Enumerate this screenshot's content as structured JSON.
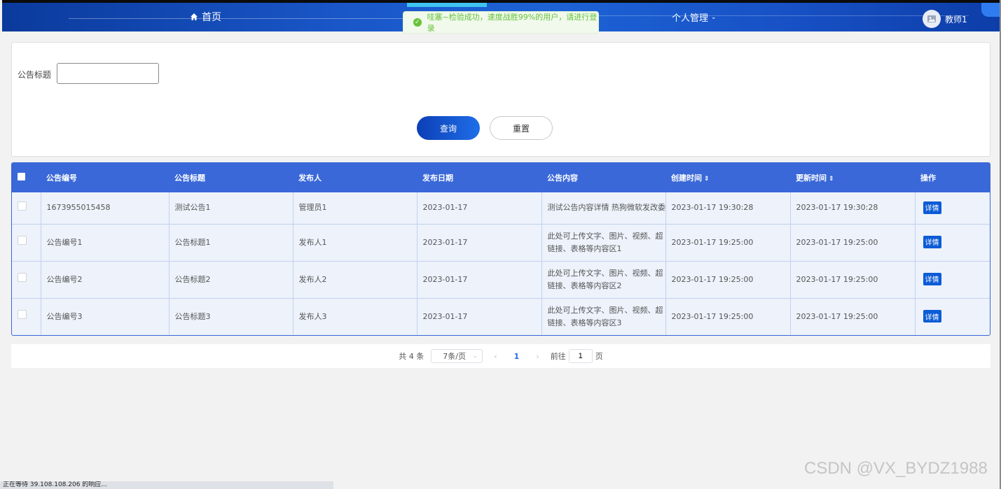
{
  "nav": {
    "home_label": "首页",
    "personal_label": "个人管理",
    "user_name": "教师1"
  },
  "toast": {
    "message": "哇塞~检验成功，速度战胜99%的用户，请进行登录",
    "color": "#67c23a"
  },
  "search": {
    "title_label": "公告标题",
    "title_value": "",
    "query_label": "查询",
    "reset_label": "重置"
  },
  "table": {
    "columns": [
      "公告编号",
      "公告标题",
      "发布人",
      "发布日期",
      "公告内容",
      "创建时间",
      "更新时间",
      "操作"
    ],
    "detail_label": "详情",
    "rows": [
      {
        "id": "1673955015458",
        "title": "测试公告1",
        "publisher": "管理员1",
        "date": "2023-01-17",
        "content": "测试公告内容详情 热狗微软发改委",
        "created": "2023-01-17 19:30:28",
        "updated": "2023-01-17 19:30:28"
      },
      {
        "id": "公告编号1",
        "title": "公告标题1",
        "publisher": "发布人1",
        "date": "2023-01-17",
        "content": "此处可上传文字、图片、视频、超链接、表格等内容区1",
        "created": "2023-01-17 19:25:00",
        "updated": "2023-01-17 19:25:00"
      },
      {
        "id": "公告编号2",
        "title": "公告标题2",
        "publisher": "发布人2",
        "date": "2023-01-17",
        "content": "此处可上传文字、图片、视频、超链接、表格等内容区2",
        "created": "2023-01-17 19:25:00",
        "updated": "2023-01-17 19:25:00"
      },
      {
        "id": "公告编号3",
        "title": "公告标题3",
        "publisher": "发布人3",
        "date": "2023-01-17",
        "content": "此处可上传文字、图片、视频、超链接、表格等内容区3",
        "created": "2023-01-17 19:25:00",
        "updated": "2023-01-17 19:25:00"
      }
    ]
  },
  "pagination": {
    "total": "共 4 条",
    "page_size": "7条/页",
    "current_page": "1",
    "goto_prefix": "前往",
    "goto_value": "1",
    "goto_suffix": "页"
  },
  "status_bar": "正在等待 39.108.108.206 的响应...",
  "watermark": "CSDN @VX_BYDZ1988",
  "colors": {
    "nav": "#1a57c9",
    "table_header": "#3a68d8",
    "row_bg": "#edf2fb",
    "primary_button": "#0c5bd6"
  }
}
